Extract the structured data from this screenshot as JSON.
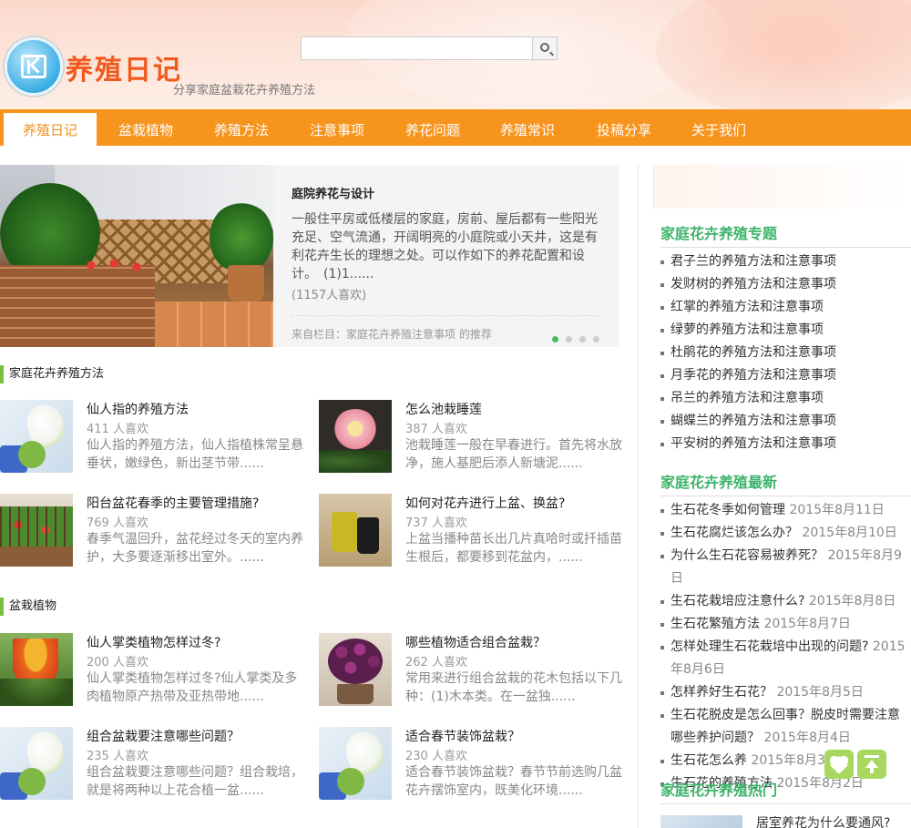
{
  "header": {
    "site_title": "养殖日记",
    "tagline": "分享家庭盆栽花卉养殖方法",
    "search_placeholder": ""
  },
  "nav": {
    "items": [
      "养殖日记",
      "盆栽植物",
      "养殖方法",
      "注意事项",
      "养花问题",
      "养殖常识",
      "投稿分享",
      "关于我们"
    ],
    "active_index": 0
  },
  "featured": {
    "title": "庭院养花与设计",
    "body": "一般住平房或低楼层的家庭，房前、屋后都有一些阳光充足、空气流通，开阔明亮的小庭院或小天井，这是有利花卉生长的理想之处。可以作如下的养花配置和设计。　(1)1......",
    "likes": "(1157人喜欢)",
    "source": "来自栏目：家庭花卉养殖注意事项 的推荐",
    "dots": 4,
    "active_dot": 0
  },
  "sections": [
    {
      "heading": "家庭花卉养殖方法",
      "articles": [
        {
          "title": "仙人指的养殖方法",
          "likes": "411 人喜欢",
          "desc": "仙人指的养殖方法，仙人指植株常呈悬垂状，嫩绿色，新出茎节带......",
          "thumb": "arum-lily-icon"
        },
        {
          "title": "怎么池栽睡莲",
          "likes": "387 人喜欢",
          "desc": "池栽睡莲一般在早春进行。首先将水放净，施人基肥后添人新塘泥......",
          "thumb": "water-lily-icon"
        },
        {
          "title": "阳台盆花春季的主要管理措施?",
          "likes": "769 人喜欢",
          "desc": "春季气温回升，盆花经过冬天的室内养护，大多要逐渐移出室外。......",
          "thumb": "balcony-flowers-icon"
        },
        {
          "title": "如何对花卉进行上盆、换盆?",
          "likes": "737 人喜欢",
          "desc": "上盆当播种苗长出几片真哈时或扦插苗生根后，都要移到花盆内，......",
          "thumb": "flower-pots-icon"
        }
      ]
    },
    {
      "heading": "盆栽植物",
      "articles": [
        {
          "title": "仙人掌类植物怎样过冬?",
          "likes": "200 人喜欢",
          "desc": "仙人掌类植物怎样过冬?仙人掌类及多肉植物原产热带及亚热带地......",
          "thumb": "bromeliad-icon"
        },
        {
          "title": "哪些植物适合组合盆栽？",
          "likes": "262 人喜欢",
          "desc": "常用来进行组合盆栽的花木包括以下几种：(1)木本类。在一盆独......",
          "thumb": "african-violet-icon"
        },
        {
          "title": "组合盆栽要注意哪些问题？",
          "likes": "235 人喜欢",
          "desc": "组合盆栽要注意哪些问题？组合栽培，就是将两种以上花合植一盆......",
          "thumb": "arum-lily-icon"
        },
        {
          "title": "适合春节装饰盆栽？",
          "likes": "230 人喜欢",
          "desc": "适合春节装饰盆栽？春节节前选购几盆花卉摆饰室内，既美化环境......",
          "thumb": "arum-lily-icon"
        }
      ]
    }
  ],
  "sidebar": {
    "topics_heading": "家庭花卉养殖专题",
    "topics": [
      "君子兰的养殖方法和注意事项",
      "发财树的养殖方法和注意事项",
      "红掌的养殖方法和注意事项",
      "绿萝的养殖方法和注意事项",
      "杜鹃花的养殖方法和注意事项",
      "月季花的养殖方法和注意事项",
      "吊兰的养殖方法和注意事项",
      "蝴蝶兰的养殖方法和注意事项",
      "平安树的养殖方法和注意事项"
    ],
    "latest_heading": "家庭花卉养殖最新",
    "latest": [
      {
        "title": "生石花冬季如何管理",
        "date": "2015年8月11日"
      },
      {
        "title": "生石花腐烂该怎么办？",
        "date": "2015年8月10日"
      },
      {
        "title": "为什么生石花容易被养死？",
        "date": "2015年8月9日"
      },
      {
        "title": "生石花栽培应注意什么?",
        "date": "2015年8月8日"
      },
      {
        "title": "生石花繁殖方法",
        "date": "2015年8月7日"
      },
      {
        "title": "怎样处理生石花栽培中出现的问题?",
        "date": "2015年8月6日"
      },
      {
        "title": "怎样养好生石花？",
        "date": "2015年8月5日"
      },
      {
        "title": "生石花脱皮是怎么回事？脱皮时需要注意哪些养护问题？",
        "date": "2015年8月4日"
      },
      {
        "title": "生石花怎么养",
        "date": "2015年8月3日"
      },
      {
        "title": "生石花的养殖方法",
        "date": "2015年8月2日"
      }
    ],
    "hot_heading": "家庭花卉养殖热门",
    "hot_first": "居室养花为什么要通风?"
  },
  "float_buttons": [
    "heart-icon",
    "back-to-top-icon"
  ],
  "colors": {
    "nav_bg": "#f7941d",
    "accent_green": "#3db36a",
    "logo_orange": "#ef5a1d",
    "section_bar": "#78c03c"
  }
}
